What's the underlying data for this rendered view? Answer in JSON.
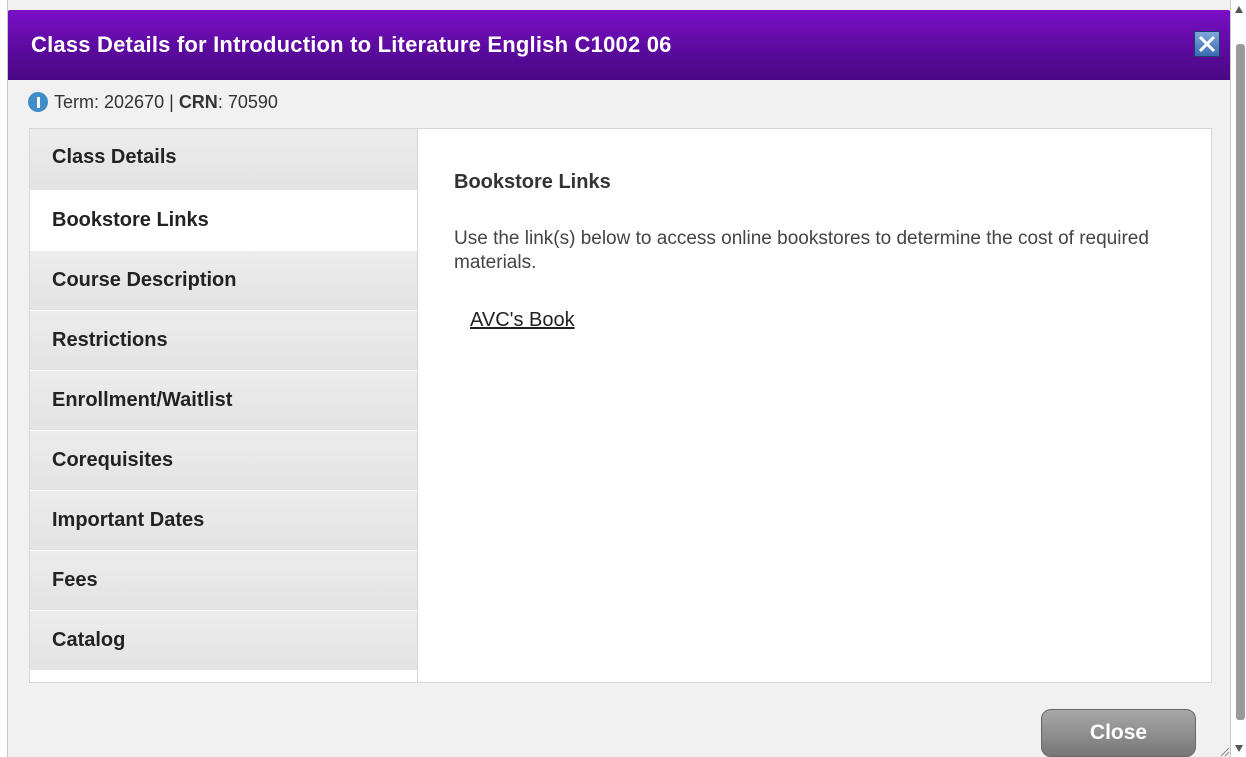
{
  "dialog": {
    "title": "Class Details for Introduction to Literature English C1002 06",
    "close_icon": "close-x-icon",
    "meta": {
      "term_label": "Term",
      "term_value": "202670",
      "separator": "|",
      "crn_label": "CRN",
      "crn_value": "70590"
    }
  },
  "tabs": [
    {
      "label": "Class Details"
    },
    {
      "label": "Bookstore Links"
    },
    {
      "label": "Course Description"
    },
    {
      "label": "Restrictions"
    },
    {
      "label": "Enrollment/Waitlist"
    },
    {
      "label": "Corequisites"
    },
    {
      "label": "Important Dates"
    },
    {
      "label": "Fees"
    },
    {
      "label": "Catalog"
    }
  ],
  "active_tab": "Bookstore Links",
  "content": {
    "heading": "Bookstore Links",
    "description": "Use the link(s) below to access online bookstores to determine the cost of required materials.",
    "link": "AVC's Book"
  },
  "footer": {
    "close_label": "Close"
  },
  "colors": {
    "titlebar": "#5a0a9b",
    "info_icon": "#3f8dc8"
  }
}
